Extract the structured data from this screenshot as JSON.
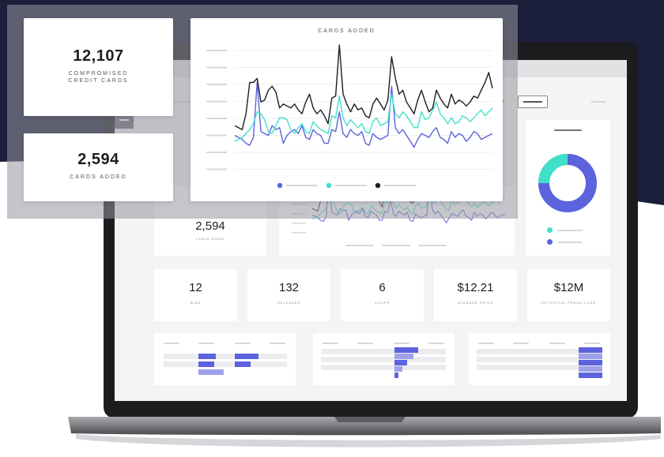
{
  "overlay": {
    "compromised_card": {
      "value": "12,107",
      "label_line1": "COMPROMISED",
      "label_line2": "CREDIT CARDS"
    },
    "cards_added_card": {
      "value": "2,594",
      "label": "CARDS ADDED"
    },
    "chart_title": "CARDS ADDED"
  },
  "dashboard": {
    "cards_added_value": "2,594",
    "cards_added_label": "CARDS ADDED",
    "stats": [
      {
        "value": "12",
        "label": "BINS"
      },
      {
        "value": "132",
        "label": "RELEASES"
      },
      {
        "value": "6",
        "label": "SHOPS"
      },
      {
        "value": "$12.21",
        "label": "AVERAGE PRICE"
      },
      {
        "value": "$12M",
        "label": "POTENTIAL FRAUD LOSS"
      }
    ],
    "donut": {
      "segments": [
        {
          "color": "#40e0c8",
          "value": 0.2
        },
        {
          "color": "#5c63dd",
          "value": 0.8
        }
      ]
    }
  },
  "colors": {
    "navy": "#1b1f3b",
    "teal": "#40e0c8",
    "indigo": "#5c63dd",
    "black": "#1d1d22",
    "orange": "#f39a3c"
  },
  "chart_data": {
    "type": "line",
    "title": "CARDS ADDED",
    "series": [
      {
        "color": "#5c63dd",
        "values": [
          38,
          36,
          34,
          30,
          28,
          36,
          92,
          42,
          40,
          38,
          48,
          44,
          46,
          30,
          38,
          42,
          44,
          40,
          48,
          36,
          34,
          44,
          40,
          38,
          30,
          30,
          44,
          42,
          62,
          40,
          36,
          44,
          40,
          38,
          42,
          30,
          28,
          40,
          36,
          34,
          36,
          38,
          88,
          46,
          40,
          44,
          38,
          32,
          26,
          34,
          40,
          38,
          36,
          42,
          46,
          36,
          34,
          30,
          42,
          36,
          40,
          38,
          32,
          36,
          42,
          40,
          34,
          36,
          38,
          40
        ]
      },
      {
        "color": "#40e0c8",
        "values": [
          32,
          34,
          36,
          40,
          44,
          50,
          62,
          60,
          54,
          42,
          40,
          48,
          56,
          56,
          54,
          44,
          40,
          46,
          50,
          42,
          40,
          52,
          48,
          44,
          42,
          40,
          58,
          56,
          78,
          56,
          48,
          54,
          50,
          46,
          50,
          42,
          40,
          52,
          56,
          48,
          50,
          52,
          80,
          60,
          56,
          62,
          58,
          52,
          46,
          46,
          62,
          54,
          56,
          64,
          72,
          60,
          56,
          50,
          56,
          50,
          52,
          58,
          56,
          52,
          56,
          60,
          64,
          58,
          62,
          66
        ]
      },
      {
        "color": "#1d1d22",
        "values": [
          48,
          46,
          44,
          60,
          92,
          92,
          96,
          72,
          74,
          84,
          88,
          82,
          66,
          70,
          68,
          66,
          70,
          64,
          60,
          72,
          80,
          66,
          60,
          64,
          58,
          50,
          76,
          78,
          130,
          80,
          70,
          62,
          70,
          64,
          66,
          58,
          56,
          70,
          76,
          70,
          64,
          74,
          118,
          96,
          80,
          84,
          72,
          66,
          60,
          74,
          84,
          72,
          62,
          66,
          84,
          76,
          70,
          66,
          80,
          70,
          74,
          72,
          68,
          72,
          78,
          76,
          84,
          92,
          102,
          86
        ]
      }
    ]
  }
}
